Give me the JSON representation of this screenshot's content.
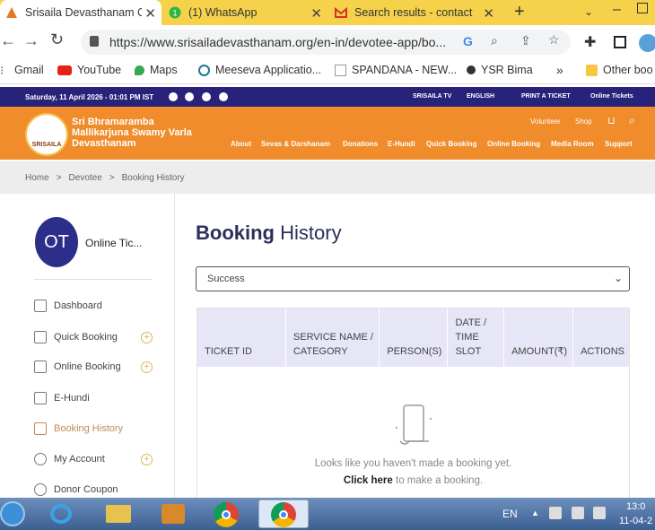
{
  "browser": {
    "tabs": [
      {
        "label": "Srisaila Devasthanam O",
        "active": true
      },
      {
        "label": "(1) WhatsApp",
        "active": false
      },
      {
        "label": "Search results - contact",
        "active": false
      }
    ],
    "new_tab": "+",
    "url": "https://www.srisailadevasthanam.org/en-in/devotee-app/bo...",
    "bookmarks": [
      "Gmail",
      "YouTube",
      "Maps",
      "Meeseva Applicatio...",
      "SPANDANA - NEW...",
      "YSR Bima"
    ],
    "bookmarks_more": "»",
    "other_bookmarks": "Other boo"
  },
  "site": {
    "date": "Saturday, 11 April 2026 - 01:01 PM IST",
    "top_links": [
      "SRISAILA TV",
      "ENGLISH",
      "PRINT A TICKET",
      "Online Tickets"
    ],
    "org_name": [
      "Sri Bhramaramba",
      "Mallikarjuna Swamy Varla",
      "Devasthanam"
    ],
    "logo_text": "SRISAILA",
    "utility_links": [
      "Volunteer",
      "Shop"
    ],
    "nav": [
      "About",
      "Sevas & Darshanam",
      "Donations",
      "E-Hundi",
      "Quick Booking",
      "Online Booking",
      "Media Room",
      "Support"
    ],
    "breadcrumb": [
      "Home",
      ">",
      "Devotee",
      ">",
      "Booking History"
    ]
  },
  "sidebar": {
    "avatar": "OT",
    "user": "Online Tic...",
    "items": [
      {
        "label": "Dashboard",
        "expandable": false
      },
      {
        "label": "Quick Booking",
        "expandable": true
      },
      {
        "label": "Online Booking",
        "expandable": true
      },
      {
        "label": "E-Hundi",
        "expandable": false
      },
      {
        "label": "Booking History",
        "expandable": false,
        "active": true
      },
      {
        "label": "My Account",
        "expandable": true
      },
      {
        "label": "Donor Coupon",
        "expandable": false
      }
    ]
  },
  "main": {
    "title_bold": "Booking",
    "title_rest": "History",
    "filter": "Success",
    "columns": [
      [
        "TICKET ID"
      ],
      [
        "SERVICE NAME /",
        "CATEGORY"
      ],
      [
        "PERSON(S)"
      ],
      [
        "DATE /",
        "TIME",
        "SLOT"
      ],
      [
        "AMOUNT(₹)"
      ],
      [
        "ACTIONS"
      ]
    ],
    "empty_text": "Looks like you haven't made a booking yet.",
    "link_text": "Click here",
    "link_rest": "to make a booking."
  },
  "taskbar": {
    "lang": "EN",
    "time": "13:0",
    "date": "11-04-2"
  },
  "colors": {
    "tabbar": "#f5d24a",
    "site_top": "#27237a",
    "site_orange": "#f08c2b",
    "avatar": "#2c2f8a",
    "table_head": "#e6e6f7"
  }
}
